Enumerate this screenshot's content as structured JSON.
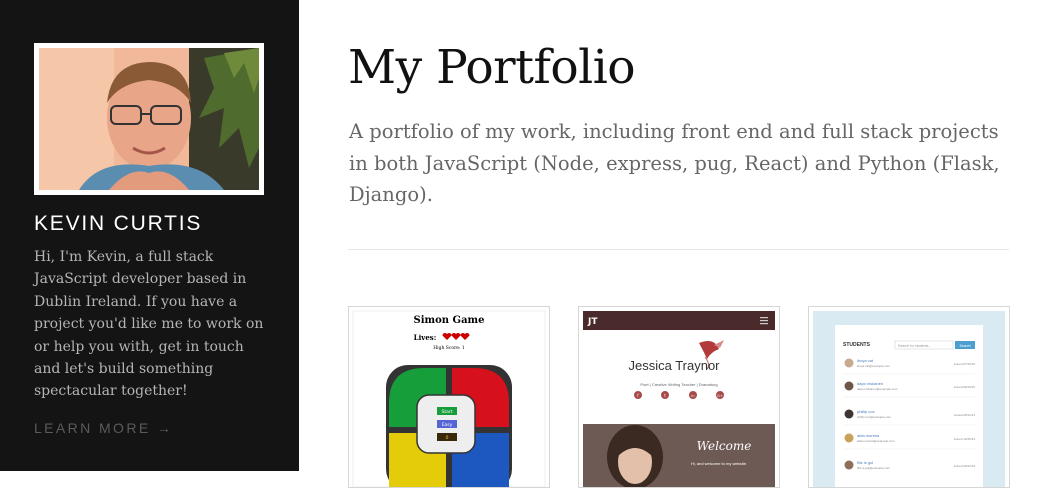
{
  "profile": {
    "name": "KEVIN CURTIS",
    "bio": "Hi, I'm Kevin, a full stack JavaScript developer based in Dublin Ireland. If you have a project you'd like me to work on or help you with, get in touch and let's build something spectacular together!",
    "learn_more": "LEARN MORE →"
  },
  "main": {
    "title": "My Portfolio",
    "subtitle": "A portfolio of my work, including front end and full stack projects in both JavaScript (Node, express, pug, React) and Python (Flask, Django)."
  },
  "projects": [
    {
      "title": "Simon Game",
      "lives_label": "Lives:",
      "high_score": "High Score: 1",
      "buttons": [
        "Start",
        "Easy",
        "0"
      ]
    },
    {
      "brand": "JT",
      "name": "Jessica Traynor",
      "tagline": "Poet | Creative Writing Teacher | Dramaturg",
      "social": [
        "f",
        "t",
        "in",
        "G+"
      ],
      "welcome": "Welcome",
      "welcome_text": "Hi, and welcome to my website."
    },
    {
      "heading": "STUDENTS",
      "search_placeholder": "Search for students...",
      "search_button": "Search",
      "students": [
        {
          "name": "iboya vat",
          "email": "iboya.vat@example.com",
          "joined": "Joined 07/15/15"
        },
        {
          "name": "aapo niskanen",
          "email": "aapo.niskanen@example.com",
          "joined": "Joined 06/15/15"
        },
        {
          "name": "phillip cox",
          "email": "phillip.cox@example.com",
          "joined": "Joined 08/11/13"
        },
        {
          "name": "alda moreira",
          "email": "alda.moreira@example.com",
          "joined": "Joined 12/25/13"
        },
        {
          "name": "filiz is gul",
          "email": "filiz.is.gul@example.com",
          "joined": "Joined 09/12/13"
        }
      ]
    }
  ]
}
